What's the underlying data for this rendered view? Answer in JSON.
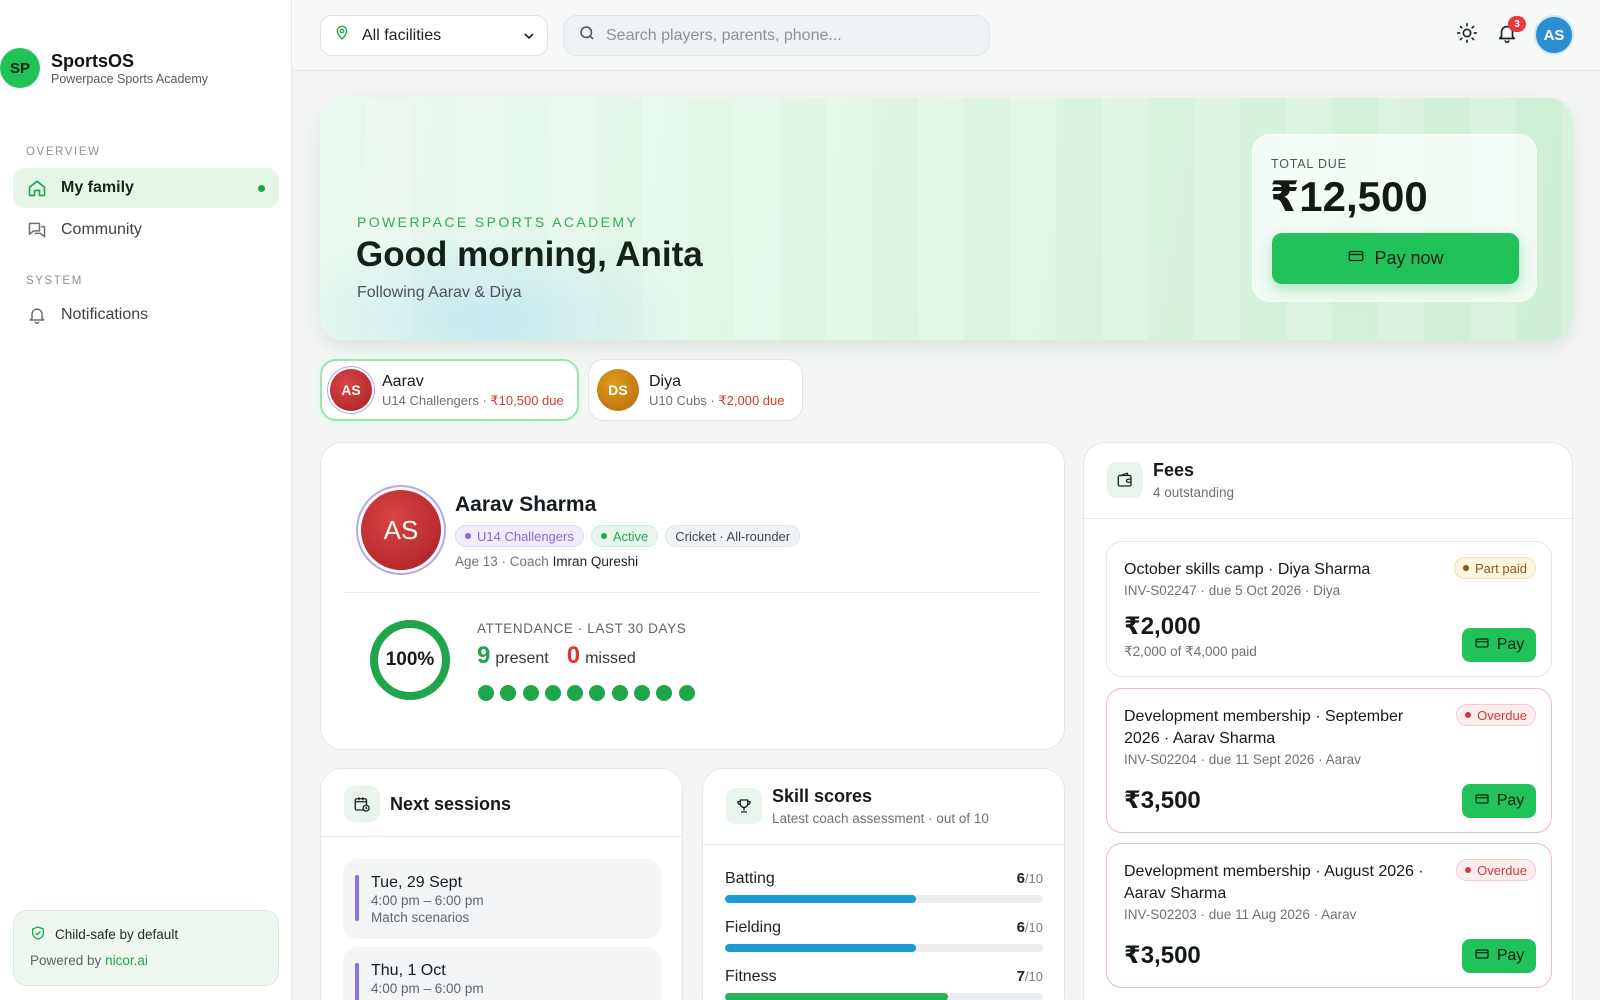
{
  "brand": {
    "logo": "SP",
    "name": "SportsOS",
    "subtitle": "Powerpace Sports Academy"
  },
  "sidebar": {
    "overview_label": "OVERVIEW",
    "system_label": "SYSTEM",
    "items": [
      {
        "label": "My family",
        "icon": "home-icon",
        "active": true
      },
      {
        "label": "Community",
        "icon": "chat-icon"
      },
      {
        "label": "Notifications",
        "icon": "bell-icon"
      }
    ],
    "safe_card": {
      "title": "Child-safe by default",
      "powered_prefix": "Powered by",
      "powered_link": "nicor.ai"
    }
  },
  "topbar": {
    "facility_value": "All facilities",
    "search_placeholder": "Search players, parents, phone...",
    "notification_count": "3",
    "avatar_initials": "AS"
  },
  "hero": {
    "eyebrow": "POWERPACE SPORTS ACADEMY",
    "greeting": "Good morning, Anita",
    "subtitle": "Following Aarav & Diya",
    "total_due_label": "TOTAL DUE",
    "total_due_amount": "₹12,500",
    "pay_now_label": "Pay now"
  },
  "children": [
    {
      "initials": "AS",
      "name": "Aarav",
      "team": "U14 Challengers · ",
      "due": "₹10,500 due",
      "color": "#b7282c",
      "active": true
    },
    {
      "initials": "DS",
      "name": "Diya",
      "team": "U10 Cubs · ",
      "due": "₹2,000 due",
      "color": "#c77d0e"
    }
  ],
  "profile": {
    "initials": "AS",
    "name": "Aarav Sharma",
    "tags": [
      "U14 Challengers",
      "Active",
      "Cricket · All-rounder"
    ],
    "meta_prefix": "Age 13 · Coach ",
    "coach": "Imran Qureshi",
    "attendance": {
      "label": "ATTENDANCE · LAST 30 DAYS",
      "percent_text": "100%",
      "percent": 100,
      "present_count": "9",
      "present_label": "present",
      "missed_count": "0",
      "missed_label": "missed",
      "sessions_attended": 10
    }
  },
  "sessions": {
    "title": "Next sessions",
    "items": [
      {
        "date": "Tue, 29 Sept",
        "time": "4:00 pm – 6:00 pm",
        "note": "Match scenarios"
      },
      {
        "date": "Thu, 1 Oct",
        "time": "4:00 pm – 6:00 pm",
        "note": ""
      }
    ]
  },
  "skills": {
    "title": "Skill scores",
    "subtitle": "Latest coach assessment · out of 10",
    "out_of": "/10",
    "items": [
      {
        "label": "Batting",
        "score": "6",
        "value": 6,
        "color": "#1a9bd6"
      },
      {
        "label": "Fielding",
        "score": "6",
        "value": 6,
        "color": "#1a9bd6"
      },
      {
        "label": "Fitness",
        "score": "7",
        "value": 7,
        "color": "#22b455"
      }
    ]
  },
  "fees": {
    "title": "Fees",
    "subtitle": "4 outstanding",
    "pay_label": "Pay",
    "items": [
      {
        "title": "October skills camp · Diya Sharma",
        "invoice": "INV-S02247 · due 5 Oct 2026 · Diya",
        "amount": "₹2,000",
        "paid_note": "₹2,000 of ₹4,000 paid",
        "status": "Part paid"
      },
      {
        "title": "Development membership · September 2026 · Aarav Sharma",
        "invoice": "INV-S02204 · due 11 Sept 2026 · Aarav",
        "amount": "₹3,500",
        "status": "Overdue"
      },
      {
        "title": "Development membership · August 2026 · Aarav Sharma",
        "invoice": "INV-S02203 · due 11 Aug 2026 · Aarav",
        "amount": "₹3,500",
        "status": "Overdue"
      }
    ]
  }
}
